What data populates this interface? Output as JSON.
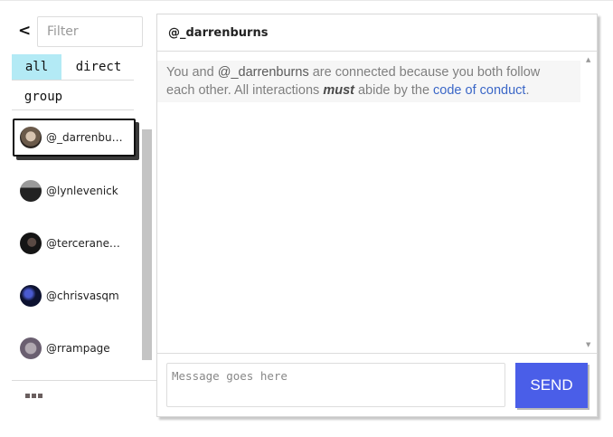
{
  "sidebar": {
    "back_label": "<",
    "filter_placeholder": "Filter",
    "tabs": [
      {
        "label": "all",
        "active": true
      },
      {
        "label": "direct",
        "active": false
      },
      {
        "label": "group",
        "active": false
      }
    ],
    "contacts": [
      {
        "name": "@_darrenburns",
        "display": "@_darrenbu…",
        "active": true
      },
      {
        "name": "@lynlevenick",
        "display": "@lynlevenick",
        "active": false
      },
      {
        "name": "@terceranex",
        "display": "@terceranex…",
        "active": false
      },
      {
        "name": "@chrisvasqm",
        "display": "@chrisvasqm",
        "active": false
      },
      {
        "name": "@rrampage",
        "display": "@rrampage",
        "active": false
      }
    ],
    "more_icon": "more-dots-icon"
  },
  "chat": {
    "header_title": "@_darrenburns",
    "notice": {
      "prefix": "You and ",
      "username": "@_darrenburns",
      "middle": " are connected because you both follow each other. All interactions ",
      "emphasis": "must",
      "suffix": " abide by the ",
      "link_text": "code of conduct",
      "end": "."
    },
    "message_placeholder": "Message goes here",
    "send_label": "SEND"
  },
  "colors": {
    "accent": "#4a5ee8",
    "active_tab": "#b3eaf5",
    "link": "#3b67c7"
  }
}
